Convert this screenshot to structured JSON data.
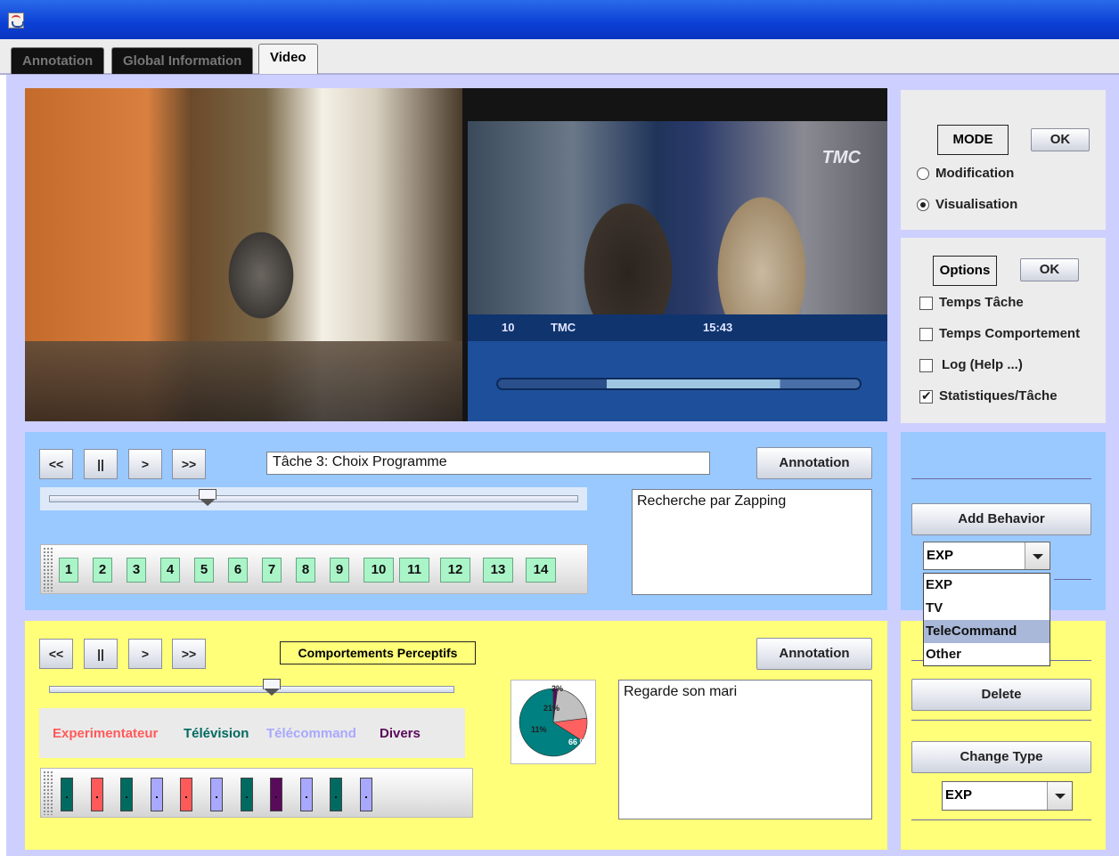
{
  "window": {
    "app_icon": "java-icon"
  },
  "tabs": [
    {
      "label": "Annotation"
    },
    {
      "label": "Global Information"
    },
    {
      "label": "Video"
    }
  ],
  "video": {
    "tv_logo": "TMC",
    "tv_channel_number": "10",
    "tv_channel_name": "TMC",
    "tv_time": "15:43"
  },
  "mode_panel": {
    "title": "MODE",
    "ok_label": "OK",
    "options": [
      {
        "label": "Modification",
        "selected": false
      },
      {
        "label": "Visualisation",
        "selected": true
      }
    ]
  },
  "options_panel": {
    "title": "Options",
    "ok_label": "OK",
    "checks": [
      {
        "label": "Temps Tâche",
        "checked": false
      },
      {
        "label": "Temps Comportement",
        "checked": false
      },
      {
        "label": "Log (Help ...)",
        "checked": false
      },
      {
        "label": "Statistiques/Tâche",
        "checked": true
      }
    ]
  },
  "task_player": {
    "rewind": "<<",
    "pause": "||",
    "play": ">",
    "forward": ">>",
    "task_field": "Tâche 3: Choix Programme",
    "annotation_label": "Annotation",
    "annotation_text": "Recherche par Zapping",
    "slider_fraction": 0.3,
    "task_numbers": [
      "1",
      "2",
      "3",
      "4",
      "5",
      "6",
      "7",
      "8",
      "9",
      "10",
      "11",
      "12",
      "13",
      "14"
    ]
  },
  "behavior_panel": {
    "add_label": "Add Behavior",
    "combo_value": "EXP",
    "dropdown_items": [
      "EXP",
      "TV",
      "TeleCommand",
      "Other"
    ],
    "dropdown_selected": "TeleCommand",
    "delete_label": "Delete",
    "change_type_label": "Change Type",
    "change_type_value": "EXP"
  },
  "behavior_player": {
    "rewind": "<<",
    "pause": "||",
    "play": ">",
    "forward": ">>",
    "category_label": "Comportements Perceptifs",
    "annotation_label": "Annotation",
    "annotation_text": "Regarde son mari",
    "slider_fraction": 0.55,
    "legend": [
      {
        "label": "Experimentateur",
        "color": "#ff5a5a"
      },
      {
        "label": "Télévision",
        "color": "#006a60"
      },
      {
        "label": "Télécommand",
        "color": "#a8a8ff"
      },
      {
        "label": "Divers",
        "color": "#5a0a5a"
      }
    ],
    "behavior_marks": [
      "#006a60",
      "#ff5a5a",
      "#006a60",
      "#a8a8ff",
      "#ff5a5a",
      "#a8a8ff",
      "#006a60",
      "#5a0a5a",
      "#a8a8ff",
      "#006a60",
      "#a8a8ff"
    ]
  },
  "chart_data": {
    "type": "pie",
    "labels": [
      "2%",
      "21%",
      "11%",
      "66 %"
    ],
    "values": [
      2,
      21,
      11,
      66
    ],
    "colors": [
      "#5a0a5a",
      "#c0c0c0",
      "#ff6060",
      "#008080"
    ]
  }
}
